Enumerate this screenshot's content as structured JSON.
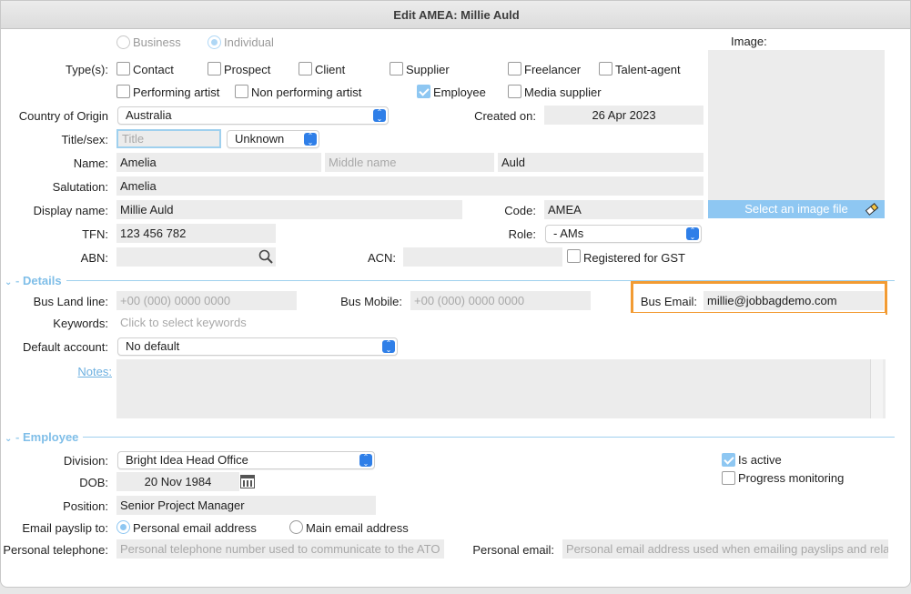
{
  "window": {
    "title": "Edit AMEA: Millie Auld"
  },
  "entity_kind": {
    "business": "Business",
    "individual": "Individual",
    "selected": "Individual"
  },
  "types": {
    "label": "Type(s):",
    "items": [
      {
        "label": "Contact",
        "checked": false
      },
      {
        "label": "Prospect",
        "checked": false
      },
      {
        "label": "Client",
        "checked": false
      },
      {
        "label": "Supplier",
        "checked": false
      },
      {
        "label": "Freelancer",
        "checked": false
      },
      {
        "label": "Talent-agent",
        "checked": false
      },
      {
        "label": "Performing artist",
        "checked": false
      },
      {
        "label": "Non performing artist",
        "checked": false
      },
      {
        "label": "Employee",
        "checked": true
      },
      {
        "label": "Media supplier",
        "checked": false
      }
    ]
  },
  "image": {
    "label": "Image:",
    "button": "Select an image file"
  },
  "country": {
    "label": "Country of Origin",
    "value": "Australia"
  },
  "created": {
    "label": "Created on:",
    "value": "26 Apr 2023"
  },
  "title_sex": {
    "label": "Title/sex:",
    "title_placeholder": "Title",
    "sex_value": "Unknown"
  },
  "name": {
    "label": "Name:",
    "first": "Amelia",
    "middle_placeholder": "Middle name",
    "last": "Auld"
  },
  "salutation": {
    "label": "Salutation:",
    "value": "Amelia"
  },
  "display_name": {
    "label": "Display name:",
    "value": "Millie Auld"
  },
  "code": {
    "label": "Code:",
    "value": "AMEA"
  },
  "tfn": {
    "label": "TFN:",
    "value": "123 456 782"
  },
  "role": {
    "label": "Role:",
    "value": "- AMs"
  },
  "abn": {
    "label": "ABN:",
    "value": ""
  },
  "acn": {
    "label": "ACN:",
    "value": ""
  },
  "gst": {
    "label": "Registered for GST",
    "checked": false
  },
  "details": {
    "section": "Details",
    "land_label": "Bus Land line:",
    "land_placeholder": "+00 (000) 0000 0000",
    "mobile_label": "Bus Mobile:",
    "mobile_placeholder": "+00 (000) 0000 0000",
    "email_label": "Bus Email:",
    "email_value": "millie@jobbagdemo.com",
    "keywords_label": "Keywords:",
    "keywords_placeholder": "Click to select keywords",
    "account_label": "Default account:",
    "account_value": "No default",
    "notes_label": "Notes:"
  },
  "employee": {
    "section": "Employee",
    "division_label": "Division:",
    "division_value": "Bright Idea Head Office",
    "dob_label": "DOB:",
    "dob_value": "20 Nov 1984",
    "position_label": "Position:",
    "position_value": "Senior Project Manager",
    "payslip_label": "Email payslip to:",
    "payslip_personal": "Personal email address",
    "payslip_main": "Main email address",
    "phone_label": "Personal telephone:",
    "phone_placeholder": "Personal telephone number used to communicate to the ATO",
    "pemail_label": "Personal email:",
    "pemail_placeholder": "Personal email address used when emailing payslips and rela",
    "is_active": "Is active",
    "is_active_checked": true,
    "progress": "Progress monitoring",
    "progress_checked": false
  },
  "colors": {
    "accent": "#8ec7f2",
    "select_blue": "#2f7fe8",
    "highlight": "#f29b33",
    "field_bg": "#ececec"
  }
}
